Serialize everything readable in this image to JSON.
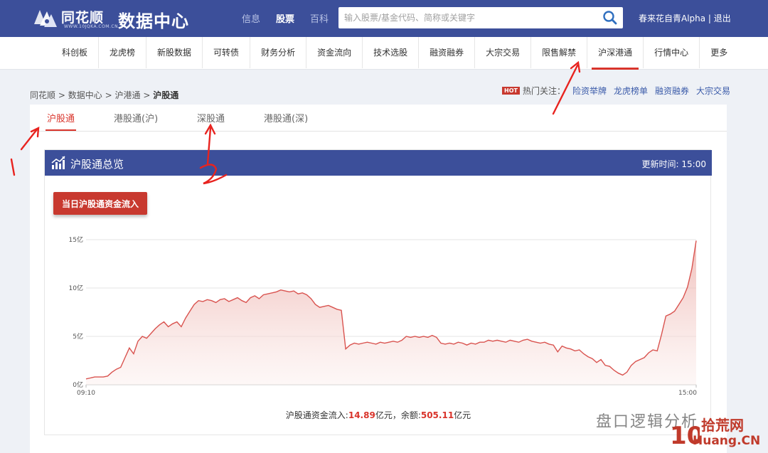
{
  "header": {
    "logo_text": "同花顺",
    "logo_sub": "WWW.10JQKA.COM.CN",
    "site_title": "数据中心",
    "nav": [
      {
        "label": "信息",
        "active": false
      },
      {
        "label": "股票",
        "active": true
      },
      {
        "label": "百科",
        "active": false
      }
    ],
    "search_placeholder": "输入股票/基金代码、简称或关键字",
    "user_text": "春来花自青Alpha | 退出"
  },
  "subnav": {
    "items": [
      "科创板",
      "龙虎榜",
      "新股数据",
      "可转债",
      "财务分析",
      "资金流向",
      "技术选股",
      "融资融券",
      "大宗交易",
      "限售解禁",
      "沪深港通",
      "行情中心",
      "更多"
    ],
    "active_index": 10
  },
  "breadcrumb": {
    "items": [
      "同花顺",
      "数据中心",
      "沪港通"
    ],
    "separator": ">",
    "current": "沪股通"
  },
  "hot": {
    "badge": "HOT",
    "label": "热门关注：",
    "links": [
      "险资举牌",
      "龙虎榜单",
      "融资融券",
      "大宗交易"
    ]
  },
  "tabs": [
    "沪股通",
    "港股通(沪)",
    "深股通",
    "港股通(深)"
  ],
  "card": {
    "title": "沪股通总览",
    "update_label": "更新时间:",
    "update_time": "15:00",
    "button_label": "当日沪股通资金流入"
  },
  "summary": {
    "prefix": "沪股通资金流入:",
    "inflow": "14.89",
    "mid": "亿元，余额:",
    "balance": "505.11",
    "suffix": "亿元"
  },
  "chart_data": {
    "type": "area",
    "x_start_label": "09:10",
    "x_end_label": "15:00",
    "y_ticks": [
      "0亿",
      "5亿",
      "10亿",
      "15亿"
    ],
    "ylim": [
      0,
      15
    ],
    "grid": true,
    "color": "#d9534f",
    "values": [
      0.6,
      0.7,
      0.8,
      0.8,
      0.8,
      0.9,
      1.3,
      1.6,
      1.8,
      2.8,
      3.8,
      3.2,
      4.5,
      5.0,
      4.8,
      5.3,
      5.8,
      6.2,
      6.5,
      6.0,
      6.3,
      6.5,
      6.0,
      6.9,
      7.6,
      8.3,
      8.7,
      8.6,
      8.8,
      8.7,
      8.5,
      8.8,
      8.9,
      8.6,
      8.8,
      9.0,
      8.7,
      8.5,
      9.0,
      9.2,
      8.9,
      9.3,
      9.4,
      9.5,
      9.6,
      9.8,
      9.7,
      9.6,
      9.7,
      9.4,
      9.5,
      9.3,
      8.9,
      8.3,
      8.0,
      8.1,
      8.2,
      8.0,
      7.8,
      7.7,
      3.7,
      4.1,
      4.3,
      4.2,
      4.3,
      4.4,
      4.3,
      4.2,
      4.4,
      4.3,
      4.4,
      4.5,
      4.4,
      4.6,
      5.0,
      4.9,
      5.0,
      4.9,
      5.0,
      4.9,
      5.1,
      4.9,
      4.3,
      4.2,
      4.3,
      4.2,
      4.4,
      4.3,
      4.1,
      4.3,
      4.2,
      4.4,
      4.4,
      4.6,
      4.5,
      4.6,
      4.5,
      4.4,
      4.6,
      4.5,
      4.4,
      4.6,
      4.7,
      4.5,
      4.4,
      4.3,
      4.4,
      4.2,
      4.1,
      3.4,
      4.0,
      3.8,
      3.7,
      3.5,
      3.6,
      3.2,
      2.9,
      2.7,
      2.3,
      2.6,
      2.0,
      1.9,
      1.5,
      1.2,
      1.0,
      1.3,
      2.0,
      2.4,
      2.6,
      2.8,
      3.3,
      3.6,
      3.5,
      5.2,
      7.1,
      7.3,
      7.6,
      8.3,
      9.0,
      10.1,
      12.0,
      14.9
    ]
  },
  "watermark": {
    "wechat": "盘口逻辑分析",
    "site1": "拾荒网",
    "site2": "Huang.CN",
    "logo_num": "10"
  }
}
